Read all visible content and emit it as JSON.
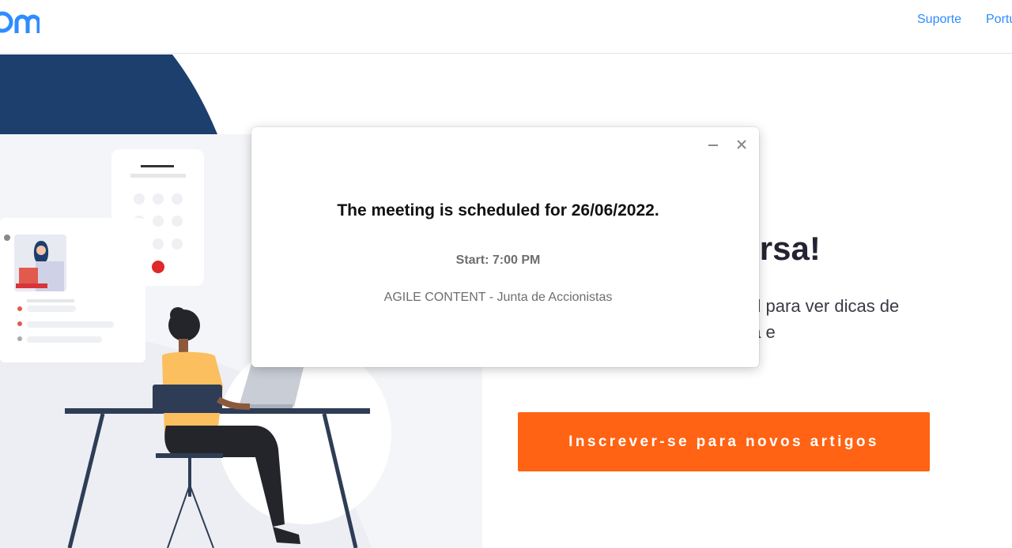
{
  "header": {
    "logo_text": "zoom",
    "nav": {
      "suporte": "Suporte",
      "language": "Português"
    }
  },
  "hero": {
    "title": "Junte-se à conversa!",
    "text_line1": "Siga-nos nas redes de mídia social para ver dicas de",
    "text_line2": "produtos, atualizações da empresa e",
    "cta_label": "Inscrever-se para novos artigos"
  },
  "modal": {
    "title": "The meeting is scheduled for 26/06/2022.",
    "start": "Start: 7:00 PM",
    "description": "AGILE CONTENT - Junta de Accionistas"
  },
  "colors": {
    "brand_blue": "#2d8cff",
    "cta_orange": "#ff6313",
    "navy": "#1c3f6e"
  }
}
